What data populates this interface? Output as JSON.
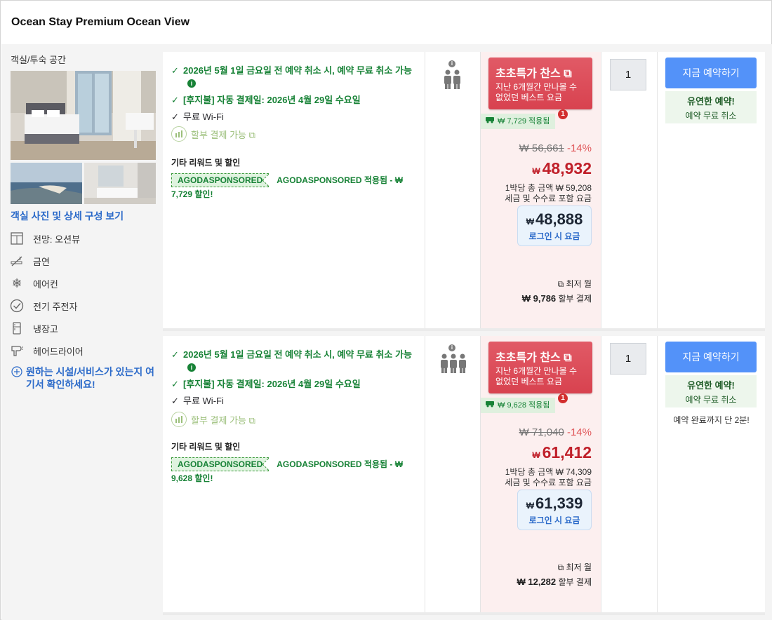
{
  "title": "Ocean Stay Premium Ocean View",
  "room": {
    "type_label": "객실/투숙 공간",
    "photos_link": "객실 사진 및 상세 구성 보기",
    "amenities": [
      {
        "label": "전망: 오션뷰",
        "icon": "window-icon"
      },
      {
        "label": "금연",
        "icon": "no-smoking-icon"
      },
      {
        "label": "에어컨",
        "icon": "snowflake-icon"
      },
      {
        "label": "전기 주전자",
        "icon": "kettle-icon"
      },
      {
        "label": "냉장고",
        "icon": "fridge-icon"
      },
      {
        "label": "헤어드라이어",
        "icon": "hairdryer-icon"
      }
    ],
    "facility_question": "원하는 시설/서비스가 있는지 여기서 확인하세요!"
  },
  "offers": [
    {
      "cancel_policy": "2026년 5월 1일 금요일 전 예약 취소 시, 예약 무료 취소 가능",
      "pay_later": "[후지불] 자동 결제일: 2026년 4월 29일 수요일",
      "wifi": "무료 Wi-Fi",
      "installment": "할부 결제 가능 ⧉",
      "rewards_heading": "기타 리워드 및 할인",
      "promo_tag": "AGODASPONSORED",
      "promo_text": "AGODASPONSORED 적용됨 - ₩ 7,729 할인!",
      "occupancy": 2,
      "deal_title": "초초특가 찬스 ⧉",
      "deal_sub": "지난 6개월간 만나볼 수 없었던 베스트 요금",
      "applied": "₩ 7,729 적용됨",
      "badge_count": "1",
      "original_price": "₩ 56,661",
      "discount_pct": "-14%",
      "currency": "₩",
      "final_price": "48,932",
      "per_night": "1박당 총 금액 ₩ 59,208",
      "taxes": "세금 및 수수료 포함 요금",
      "login_price": "48,888",
      "login_label": "로그인 시 요금",
      "monthly_label": "⧉ 최저 월",
      "monthly_amount": "₩ 9,786",
      "monthly_suffix": "할부 결제",
      "qty": "1",
      "book_label": "지금 예약하기",
      "flex_title": "유연한 예약!",
      "flex_sub": "예약 무료 취소",
      "urgency": ""
    },
    {
      "cancel_policy": "2026년 5월 1일 금요일 전 예약 취소 시, 예약 무료 취소 가능",
      "pay_later": "[후지불] 자동 결제일: 2026년 4월 29일 수요일",
      "wifi": "무료 Wi-Fi",
      "installment": "할부 결제 가능 ⧉",
      "rewards_heading": "기타 리워드 및 할인",
      "promo_tag": "AGODASPONSORED",
      "promo_text": "AGODASPONSORED 적용됨 - ₩ 9,628 할인!",
      "occupancy": 3,
      "deal_title": "초초특가 찬스 ⧉",
      "deal_sub": "지난 6개월간 만나볼 수 없었던 베스트 요금",
      "applied": "₩ 9,628 적용됨",
      "badge_count": "1",
      "original_price": "₩ 71,040",
      "discount_pct": "-14%",
      "currency": "₩",
      "final_price": "61,412",
      "per_night": "1박당 총 금액 ₩ 74,309",
      "taxes": "세금 및 수수료 포함 요금",
      "login_price": "61,339",
      "login_label": "로그인 시 요금",
      "monthly_label": "⧉ 최저 월",
      "monthly_amount": "₩ 12,282",
      "monthly_suffix": "할부 결제",
      "qty": "1",
      "book_label": "지금 예약하기",
      "flex_title": "유연한 예약!",
      "flex_sub": "예약 무료 취소",
      "urgency": "예약 완료까지 단 2분!"
    }
  ],
  "colors": {
    "accent": "#5392f9",
    "deal": "#d8424f",
    "price": "#c0202a",
    "green": "#178236"
  }
}
